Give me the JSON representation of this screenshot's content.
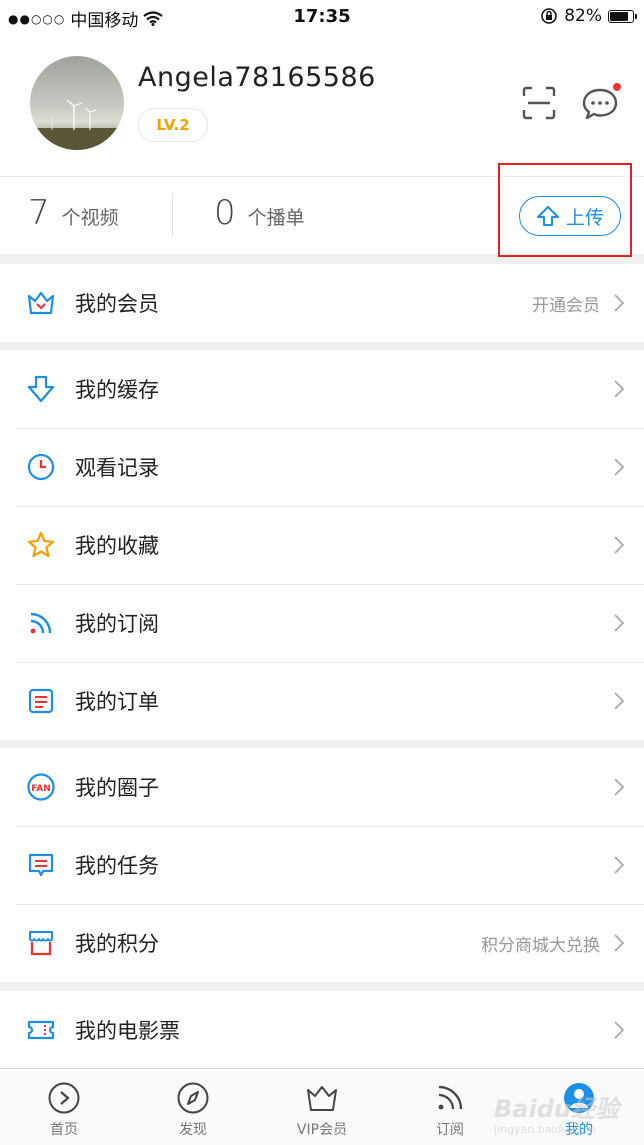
{
  "status_bar": {
    "signal": "●●○○○",
    "carrier": "中国移动",
    "time": "17:35",
    "battery_percent": "82%",
    "battery_level": 0.82
  },
  "profile": {
    "username": "Angela78165586",
    "level": "LV.2",
    "icons": {
      "scan": "scan-icon",
      "message": "message-icon"
    },
    "notification_dot_color": "#f0322e"
  },
  "stats": {
    "videos_count": "7",
    "videos_label": "个视频",
    "playlists_count": "0",
    "playlists_label": "个播单",
    "upload_label": "上传"
  },
  "colors": {
    "accent": "#1c8fe6",
    "highlight": "#e0231e",
    "level": "#f5a100"
  },
  "sections": [
    {
      "rows": [
        {
          "icon": "crown-icon",
          "label": "我的会员",
          "right_text": "开通会员"
        }
      ]
    },
    {
      "rows": [
        {
          "icon": "download-icon",
          "label": "我的缓存",
          "right_text": ""
        },
        {
          "icon": "clock-icon",
          "label": "观看记录",
          "right_text": ""
        },
        {
          "icon": "star-icon",
          "label": "我的收藏",
          "right_text": ""
        },
        {
          "icon": "rss-icon",
          "label": "我的订阅",
          "right_text": ""
        },
        {
          "icon": "order-icon",
          "label": "我的订单",
          "right_text": ""
        }
      ]
    },
    {
      "rows": [
        {
          "icon": "fan-icon",
          "label": "我的圈子",
          "right_text": ""
        },
        {
          "icon": "task-icon",
          "label": "我的任务",
          "right_text": ""
        },
        {
          "icon": "points-icon",
          "label": "我的积分",
          "right_text": "积分商城大兑换"
        }
      ]
    },
    {
      "rows": [
        {
          "icon": "ticket-icon",
          "label": "我的电影票",
          "right_text": ""
        }
      ]
    }
  ],
  "tabbar": [
    {
      "icon": "play-circle-icon",
      "label": "首页"
    },
    {
      "icon": "compass-icon",
      "label": "发现"
    },
    {
      "icon": "crown-icon",
      "label": "VIP会员"
    },
    {
      "icon": "rss-icon",
      "label": "订阅"
    },
    {
      "icon": "profile-icon",
      "label": "我的",
      "active": true
    }
  ],
  "watermark": {
    "text": "Baidu经验",
    "sub": "jingyan.baidu.com"
  }
}
